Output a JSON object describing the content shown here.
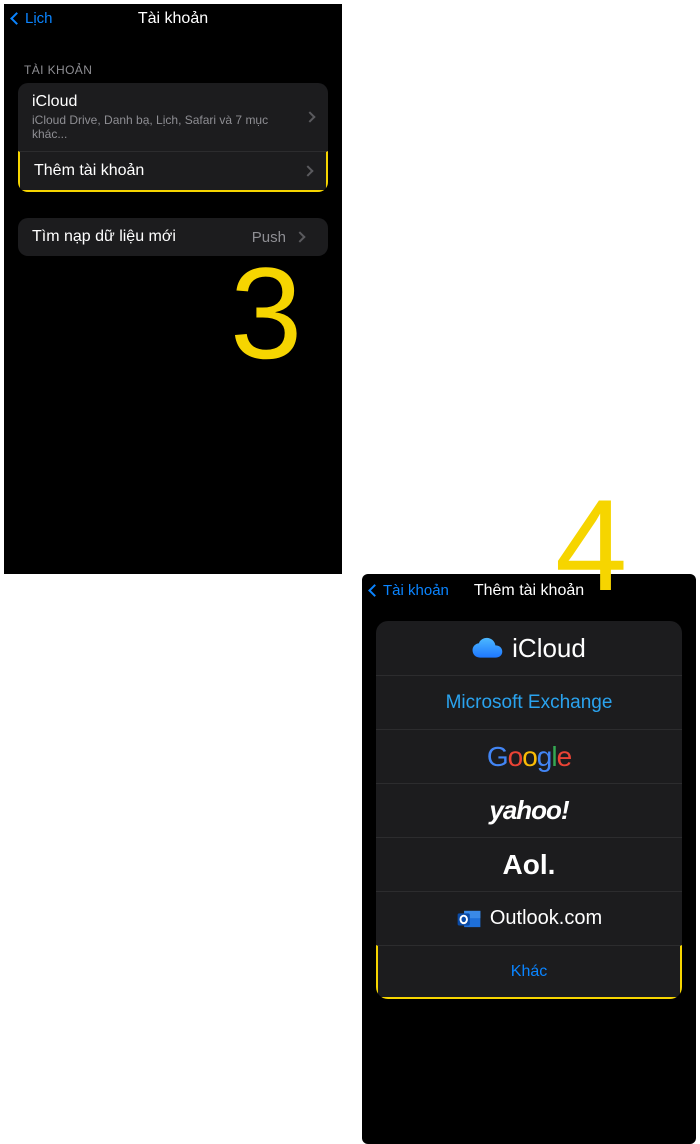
{
  "screen3": {
    "back_label": "Lịch",
    "title": "Tài khoản",
    "section_header": "TÀI KHOẢN",
    "accounts": {
      "icloud_title": "iCloud",
      "icloud_sub": "iCloud Drive, Danh bạ, Lịch, Safari và 7 mục khác...",
      "add_label": "Thêm tài khoản"
    },
    "fetch": {
      "label": "Tìm nạp dữ liệu mới",
      "value": "Push"
    },
    "step_number": "3"
  },
  "screen4": {
    "back_label": "Tài khoản",
    "title": "Thêm tài khoản",
    "providers": {
      "icloud": "iCloud",
      "exchange": "Microsoft Exchange",
      "yahoo": "yahoo!",
      "aol": "Aol.",
      "outlook": "Outlook.com",
      "other": "Khác"
    },
    "step_number": "4"
  }
}
